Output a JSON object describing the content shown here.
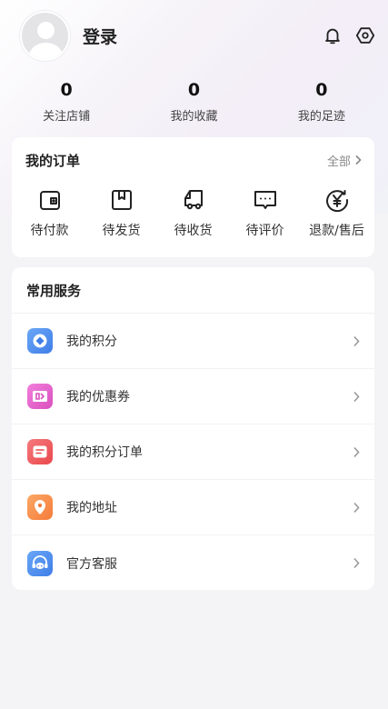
{
  "header": {
    "login_label": "登录",
    "icons": [
      "bell-icon",
      "settings-hexagon-icon"
    ]
  },
  "stats": [
    {
      "count": "0",
      "label": "关注店铺"
    },
    {
      "count": "0",
      "label": "我的收藏"
    },
    {
      "count": "0",
      "label": "我的足迹"
    }
  ],
  "orders": {
    "title": "我的订单",
    "all_label": "全部",
    "items": [
      {
        "label": "待付款",
        "icon": "wallet-icon"
      },
      {
        "label": "待发货",
        "icon": "package-icon"
      },
      {
        "label": "待收货",
        "icon": "delivery-truck-icon"
      },
      {
        "label": "待评价",
        "icon": "comment-icon"
      },
      {
        "label": "退款/售后",
        "icon": "refund-yuan-icon"
      }
    ]
  },
  "services": {
    "title": "常用服务",
    "items": [
      {
        "label": "我的积分",
        "icon": "points-icon",
        "color": "#4d8ef0"
      },
      {
        "label": "我的优惠券",
        "icon": "coupon-icon",
        "color": "#ea5fcf"
      },
      {
        "label": "我的积分订单",
        "icon": "points-order-icon",
        "color": "#f0585c"
      },
      {
        "label": "我的地址",
        "icon": "location-pin-icon",
        "color": "#f78e4a"
      },
      {
        "label": "官方客服",
        "icon": "customer-service-icon",
        "color": "#4d8ef0"
      }
    ]
  },
  "colors": {
    "background": "#f4f4f6",
    "card": "#ffffff",
    "text_primary": "#222222",
    "text_muted": "#888888"
  }
}
